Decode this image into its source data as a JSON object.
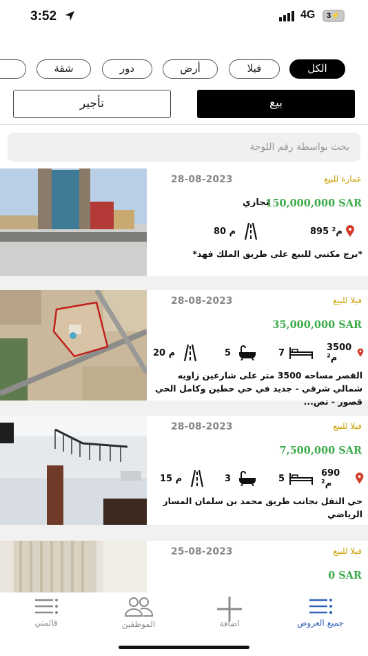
{
  "status_bar": {
    "time": "3:52",
    "network": "4G",
    "battery": "3"
  },
  "categories": [
    {
      "label": "الكل",
      "active": true
    },
    {
      "label": "فيلا",
      "active": false
    },
    {
      "label": "أرض",
      "active": false
    },
    {
      "label": "دور",
      "active": false
    },
    {
      "label": "شقة",
      "active": false
    }
  ],
  "mode": {
    "sale_label": "بيع",
    "rent_label": "تأجير"
  },
  "search": {
    "placeholder": "بحث بواسطة رقم اللوحة"
  },
  "listings": [
    {
      "date": "28-08-2023",
      "type": "عمارة للبيع",
      "price": "150,000,000 SAR",
      "usage": "تجاري",
      "area": "895 م²",
      "street": "80 م",
      "description": "*برج مكتبي للبيع على طريق الملك فهد*"
    },
    {
      "date": "28-08-2023",
      "type": "فيلا للبيع",
      "price": "35,000,000 SAR",
      "area": "3500 م²",
      "bedrooms": "7",
      "bathrooms": "5",
      "street": "20 م",
      "description": "القصر مساحه 3500 متر على شارعين زاويه شمالي شرقي - جديد في حي حطين  وكامل الحي قصور - تص..."
    },
    {
      "date": "28-08-2023",
      "type": "فيلا للبيع",
      "price": "7,500,000 SAR",
      "area": "690 م²",
      "bedrooms": "5",
      "bathrooms": "3",
      "street": "15 م",
      "description": "حي النقل بجانب طريق محمد بن سلمان المسار الرياضي"
    },
    {
      "date": "25-08-2023",
      "type": "فيلا للبيع",
      "price": "0 SAR"
    }
  ],
  "nav": [
    {
      "label": "جميع العروض",
      "icon": "list-icon",
      "active": true
    },
    {
      "label": "اضافة",
      "icon": "plus-icon",
      "active": false
    },
    {
      "label": "الموظفين",
      "icon": "users-icon",
      "active": false
    },
    {
      "label": "قائمتي",
      "icon": "menu-icon",
      "active": false
    }
  ],
  "colors": {
    "price": "#3caa4a",
    "type": "#c8a000",
    "accent": "#2f62b8"
  }
}
